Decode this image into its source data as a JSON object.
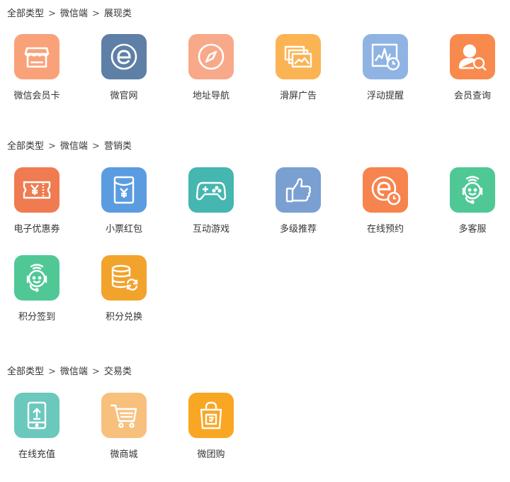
{
  "sections": [
    {
      "breadcrumb": {
        "root": "全部类型",
        "channel": "微信端",
        "category": "展现类",
        "sep": ">"
      },
      "items": [
        {
          "label": "微信会员卡",
          "icon": "storefront-icon",
          "color": "#f9a27a"
        },
        {
          "label": "微官网",
          "icon": "browser-e-icon",
          "color": "#5e7fa6"
        },
        {
          "label": "地址导航",
          "icon": "compass-icon",
          "color": "#f7a98a"
        },
        {
          "label": "滑屏广告",
          "icon": "image-slides-icon",
          "color": "#fbb454"
        },
        {
          "label": "浮动提醒",
          "icon": "chart-clock-icon",
          "color": "#8fb4e3"
        },
        {
          "label": "会员查询",
          "icon": "user-search-icon",
          "color": "#f98a4e"
        }
      ]
    },
    {
      "breadcrumb": {
        "root": "全部类型",
        "channel": "微信端",
        "category": "营销类",
        "sep": ">"
      },
      "items": [
        {
          "label": "电子优惠券",
          "icon": "coupon-ticket-icon",
          "color": "#f07b51"
        },
        {
          "label": "小票红包",
          "icon": "red-envelope-icon",
          "color": "#5b9ce0"
        },
        {
          "label": "互动游戏",
          "icon": "gamepad-icon",
          "color": "#45b6b0"
        },
        {
          "label": "多级推荐",
          "icon": "thumbs-up-icon",
          "color": "#7aa0d2"
        },
        {
          "label": "在线预约",
          "icon": "browser-clock-icon",
          "color": "#f7844e"
        },
        {
          "label": "多客服",
          "icon": "headset-agent-icon",
          "color": "#4fc896"
        },
        {
          "label": "积分签到",
          "icon": "headset-agent-icon",
          "color": "#4fc896"
        },
        {
          "label": "积分兑换",
          "icon": "database-exchange-icon",
          "color": "#f2a32c"
        }
      ]
    },
    {
      "breadcrumb": {
        "root": "全部类型",
        "channel": "微信端",
        "category": "交易类",
        "sep": ">"
      },
      "items": [
        {
          "label": "在线充值",
          "icon": "phone-upload-icon",
          "color": "#6ac8bd"
        },
        {
          "label": "微商城",
          "icon": "shopping-cart-icon",
          "color": "#f8c07d"
        },
        {
          "label": "微团购",
          "icon": "shopping-bag-icon",
          "color": "#f9a623"
        }
      ]
    }
  ]
}
